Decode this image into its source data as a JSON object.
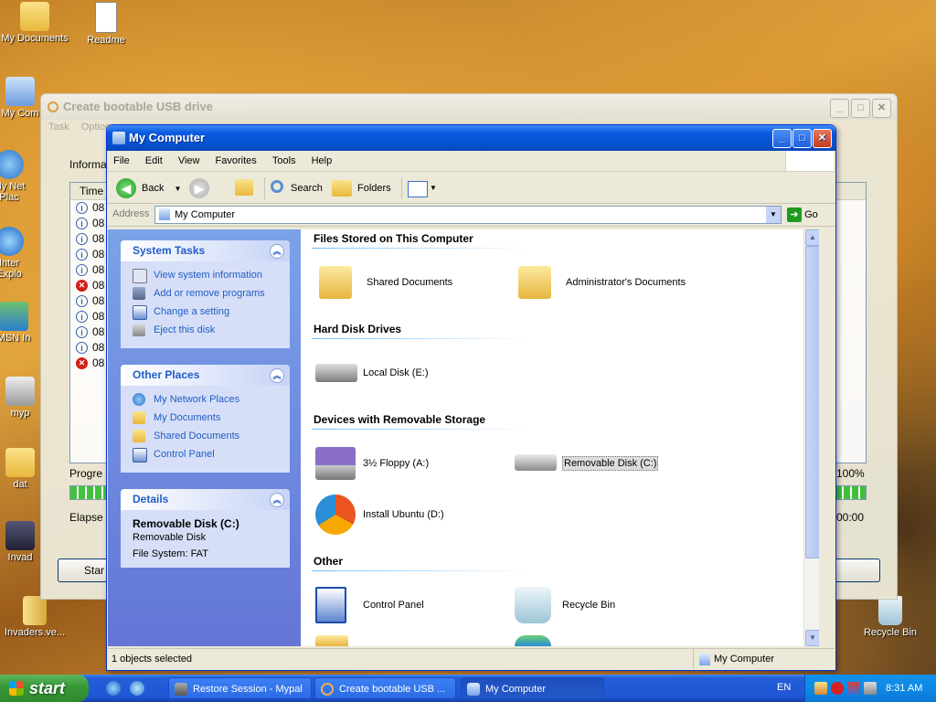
{
  "desktop": {
    "icons": [
      {
        "label": "My Documents",
        "icon": "folder-documents-icon"
      },
      {
        "label": "Readme",
        "icon": "text-file-icon"
      },
      {
        "label": "My Com",
        "icon": "computer-icon"
      },
      {
        "label": "My Net",
        "icon": "network-icon"
      },
      {
        "label": "Plac",
        "icon": "network-icon"
      },
      {
        "label": "Inter",
        "icon": "ie-icon"
      },
      {
        "label": "Explo",
        "icon": "ie-icon"
      },
      {
        "label": "MSN In",
        "icon": "msn-icon"
      },
      {
        "label": "myp",
        "icon": "app-icon"
      },
      {
        "label": "dat",
        "icon": "folder-icon"
      },
      {
        "label": "Invad",
        "icon": "game-icon"
      },
      {
        "label": "Invaders.ve...",
        "icon": "zip-icon"
      },
      {
        "label": "Recycle Bin",
        "icon": "recycle-bin-icon"
      }
    ]
  },
  "bg_window": {
    "title": "Create bootable USB drive",
    "menu": [
      "Task",
      "Option"
    ],
    "info_label": "Informa",
    "list_header": "Time",
    "rows": [
      {
        "type": "info",
        "time": "08"
      },
      {
        "type": "info",
        "time": "08"
      },
      {
        "type": "info",
        "time": "08"
      },
      {
        "type": "info",
        "time": "08"
      },
      {
        "type": "info",
        "time": "08"
      },
      {
        "type": "error",
        "time": "08"
      },
      {
        "type": "info",
        "time": "08"
      },
      {
        "type": "info",
        "time": "08"
      },
      {
        "type": "info",
        "time": "08"
      },
      {
        "type": "info",
        "time": "08"
      },
      {
        "type": "error",
        "time": "08"
      }
    ],
    "progress_label": "Progre",
    "progress_value": "100%",
    "progress": 1.0,
    "elapsed_label": "Elapse",
    "elapsed_value": "00:00",
    "start_button": "Star"
  },
  "window": {
    "title": "My Computer",
    "menu": [
      "File",
      "Edit",
      "View",
      "Favorites",
      "Tools",
      "Help"
    ],
    "toolbar": {
      "back": "Back",
      "search": "Search",
      "folders": "Folders"
    },
    "address_label": "Address",
    "address_value": "My Computer",
    "go": "Go",
    "tasks": {
      "system_title": "System Tasks",
      "system_items": [
        "View system information",
        "Add or remove programs",
        "Change a setting",
        "Eject this disk"
      ],
      "other_title": "Other Places",
      "other_items": [
        "My Network Places",
        "My Documents",
        "Shared Documents",
        "Control Panel"
      ],
      "details_title": "Details",
      "details_name": "Removable Disk (C:)",
      "details_type": "Removable Disk",
      "details_fs": "File System: FAT"
    },
    "groups": {
      "files": "Files Stored on This Computer",
      "hdd": "Hard Disk Drives",
      "removable": "Devices with Removable Storage",
      "other": "Other"
    },
    "items": {
      "shared_docs": "Shared Documents",
      "admin_docs": "Administrator's Documents",
      "local_disk": "Local Disk (E:)",
      "floppy": "3½ Floppy (A:)",
      "removable": "Removable Disk (C:)",
      "ubuntu": "Install Ubuntu (D:)",
      "control_panel": "Control Panel",
      "recycle_bin": "Recycle Bin"
    },
    "status_left": "1 objects selected",
    "status_right": "My Computer"
  },
  "taskbar": {
    "start": "start",
    "tasks": [
      {
        "label": "Restore Session - Mypal",
        "active": false
      },
      {
        "label": "Create bootable USB ...",
        "active": false
      },
      {
        "label": "My Computer",
        "active": true
      }
    ],
    "lang": "EN",
    "time": "8:31 AM"
  }
}
